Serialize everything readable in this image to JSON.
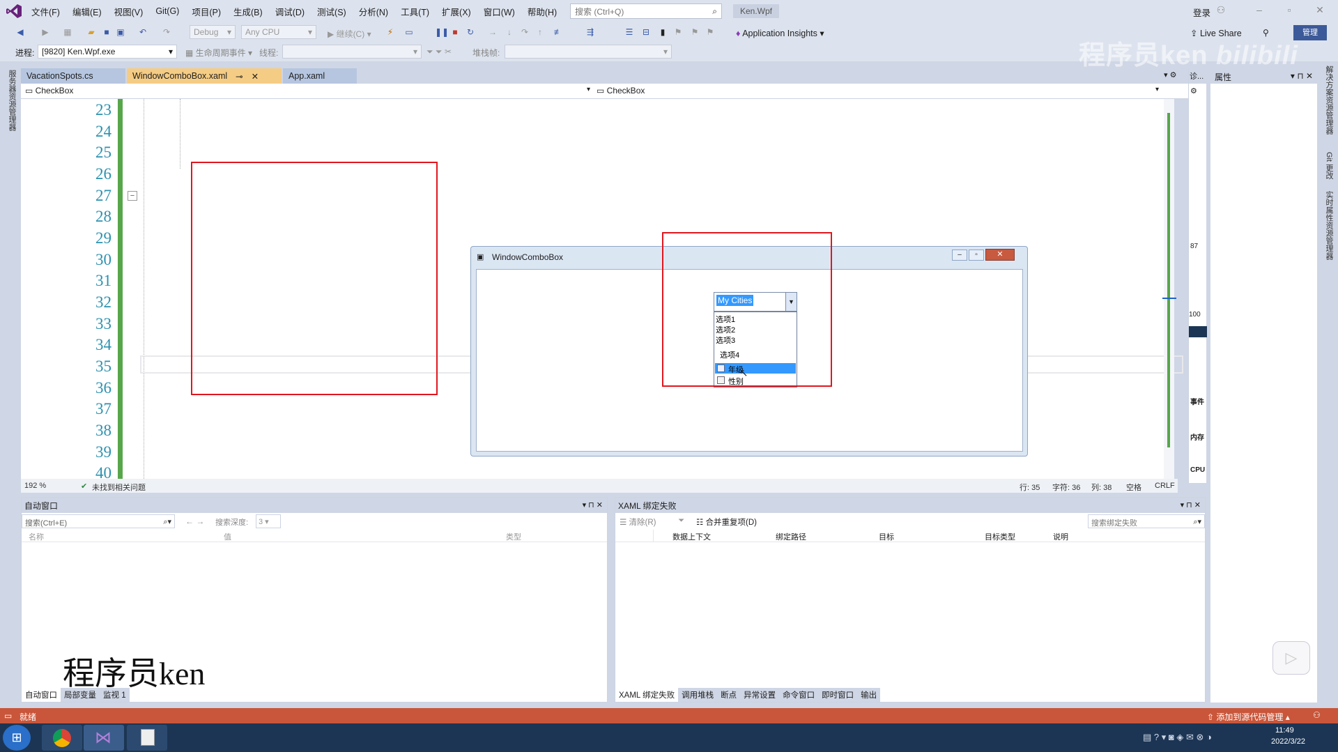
{
  "titlebar": {
    "menus": [
      "文件(F)",
      "编辑(E)",
      "视图(V)",
      "Git(G)",
      "项目(P)",
      "生成(B)",
      "调试(D)",
      "测试(S)",
      "分析(N)",
      "工具(T)",
      "扩展(X)",
      "窗口(W)",
      "帮助(H)"
    ],
    "search_placeholder": "搜索 (Ctrl+Q)",
    "solution": "Ken.Wpf",
    "login": "登录"
  },
  "toolbar": {
    "config": "Debug",
    "platform": "Any CPU",
    "continue": "继续(C)",
    "insights": "Application Insights",
    "liveshare": "Live Share",
    "admin": "管理",
    "process_label": "进程:",
    "process": "[9820] Ken.Wpf.exe",
    "lifecycle": "生命周期事件",
    "thread_label": "线程:",
    "stack_label": "堆栈帧:"
  },
  "doctabs": [
    {
      "label": "VacationSpots.cs",
      "active": false
    },
    {
      "label": "WindowComboBox.xaml",
      "active": true
    },
    {
      "label": "App.xaml",
      "active": false
    }
  ],
  "navbar": {
    "left": "CheckBox",
    "right": "CheckBox"
  },
  "editor": {
    "line_numbers": [
      "23",
      "24",
      "25",
      "26",
      "27",
      "28",
      "29",
      "30",
      "31",
      "32",
      "33",
      "34",
      "35",
      "36",
      "37",
      "38",
      "39",
      "40"
    ],
    "zoom": "192 %",
    "issues": "未找到相关问题",
    "row": "行: 35",
    "char": "字符: 36",
    "col": "列: 38",
    "spaces": "空格",
    "eol": "CRLF"
  },
  "wpf_window": {
    "title": "WindowComboBox",
    "combo_text": "My Cities",
    "items": [
      "选项1",
      "选项2",
      "选项3",
      "选项4",
      "年级",
      "性别"
    ]
  },
  "panes": {
    "autos": {
      "title": "自动窗口",
      "search_placeholder": "搜索(Ctrl+E)",
      "depth_label": "搜索深度:",
      "depth": "3",
      "columns": [
        "名称",
        "值",
        "类型"
      ],
      "tabs": [
        "自动窗口",
        "局部变量",
        "监视 1"
      ]
    },
    "xaml": {
      "title": "XAML 绑定失败",
      "clear": "清除(R)",
      "merge": "合并重复项(D)",
      "search_placeholder": "搜索绑定失败",
      "columns": [
        "数据上下文",
        "绑定路径",
        "目标",
        "目标类型",
        "说明"
      ],
      "tabs": [
        "XAML 绑定失败",
        "调用堆栈",
        "断点",
        "异常设置",
        "命令窗口",
        "即时窗口",
        "输出"
      ]
    }
  },
  "diag": {
    "title": "诊...",
    "events": "事件",
    "memory": "内存",
    "cpu": "CPU",
    "v1": "87",
    "v2": "100"
  },
  "props_title": "属性",
  "side_labels": {
    "left": "服务器资源管理器",
    "right1": "解决方案资源管理器",
    "right2": "Git 更改",
    "right3": "实时属性资源管理器"
  },
  "status": {
    "ready": "就绪",
    "source_control": "添加到源代码管理"
  },
  "taskbar": {
    "time": "11:49",
    "date": "2022/3/22"
  },
  "watermark": {
    "top": "程序员ken",
    "bottom": "程序员ken",
    "brand": "bilibili"
  },
  "colors": {
    "accent": "#3b5ba9",
    "highlight_box": "#e0161e",
    "tab_active": "#f5cc84",
    "statusbar": "#c9563a"
  }
}
